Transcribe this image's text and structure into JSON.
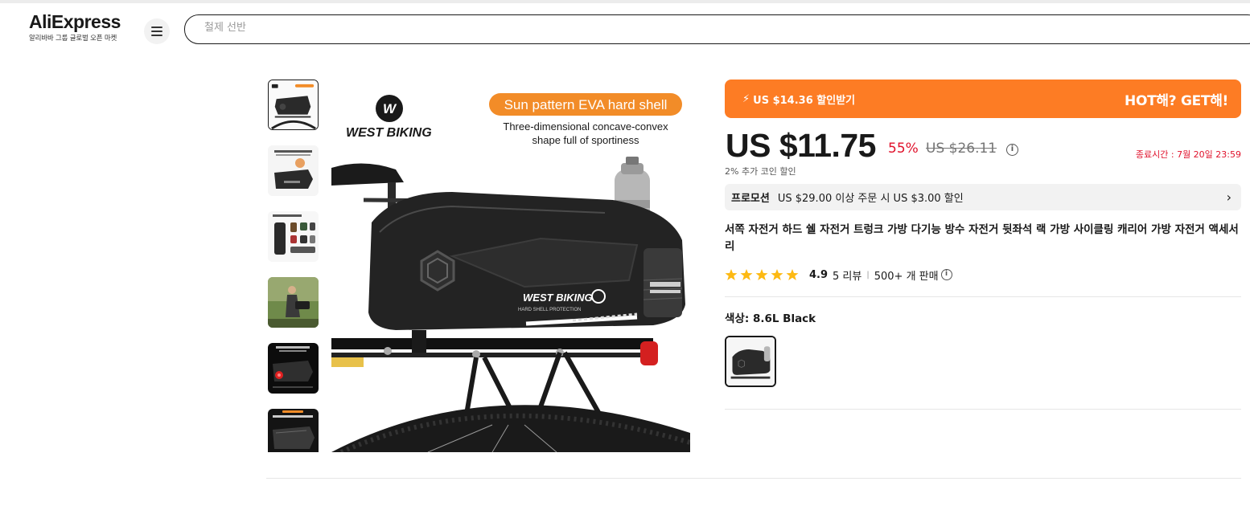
{
  "header": {
    "logo_main": "AliExpress",
    "logo_sub": "알리바바 그룹 글로벌 오픈 마켓",
    "menu_icon": "hamburger-icon",
    "search_placeholder": "철제 선반"
  },
  "gallery": {
    "main_image": {
      "brand": "WEST BIKING",
      "headline": "Sun pattern EVA hard shell",
      "subline_1": "Three-dimensional concave-convex",
      "subline_2": "shape full of sportiness",
      "bag_brand": "WEST BIKING",
      "bag_sub": "HARD SHELL PROTECTION"
    },
    "thumbnails": [
      {
        "caption": ""
      },
      {
        "caption": "TRIGGERS PROOF, AND HOLE EASY TO GIRDER"
      },
      {
        "caption": "8.6L LARGE CAPACITY"
      },
      {
        "caption": ""
      },
      {
        "caption": "TAILLIGHT BUCKLE MAKES NIGHT RIDINGS SAFER"
      },
      {
        "caption": "SPLASH-PROOF, RAIN OR SHINE"
      }
    ]
  },
  "promo_banner": {
    "icon": "bolt-icon",
    "left_text": "US $14.36 할인받기",
    "right_text": "HOT해? GET해!",
    "color": "#fd7c24"
  },
  "price": {
    "current": "US $11.75",
    "discount": "55%",
    "original": "US $26.11",
    "info_icon": "i",
    "end_time": "종료시간 :  7월 20일 23:59",
    "coins": "2% 추가 코인 할인"
  },
  "promotion": {
    "tag": "프로모션",
    "text": "US $29.00 이상 주문 시 US $3.00 할인",
    "chevron": "›"
  },
  "product": {
    "title": "서쪽 자전거 하드 쉘 자전거 트렁크 가방 다기능 방수 자전거 뒷좌석 랙 가방 사이클링 캐리어 가방 자전거 액세서리",
    "rating": "4.9",
    "reviews": "5 리뷰",
    "separator": "|",
    "sold": "500+ 개 판매",
    "stars": 5
  },
  "variant": {
    "label": "색상: 8.6L Black"
  },
  "colors": {
    "accent": "#fd7c24",
    "sale_red": "#e0112b",
    "star": "#fdb913"
  }
}
